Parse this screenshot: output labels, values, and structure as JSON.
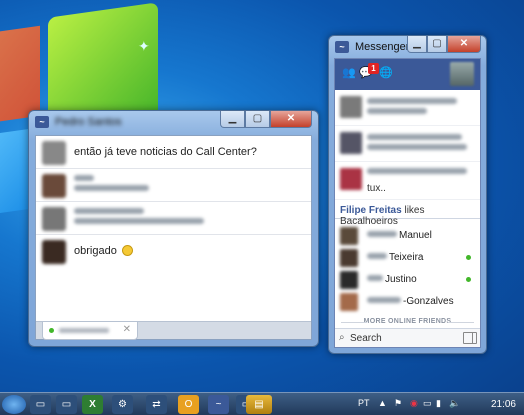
{
  "chat_window": {
    "title": "Pedro Santos",
    "messages": [
      {
        "text": "então já teve noticias do Call Center?",
        "blurred": false,
        "avatar_color": "#888888"
      },
      {
        "text": "",
        "blurred": true,
        "avatar_color": "#6a4a3a"
      },
      {
        "text": "",
        "blurred": true,
        "avatar_color": "#777777"
      },
      {
        "text": "obrigado",
        "blurred": false,
        "emoticon": "smile",
        "avatar_color": "#3a2a22"
      }
    ]
  },
  "messenger": {
    "title": "Messenger",
    "badge_count": "1",
    "notifications": [
      {
        "bold": "Lilian Fonseca",
        "rest": "",
        "avatar_color": "#7a7a7a"
      },
      {
        "bold": "Rosinéia Lopes Dias",
        "rest": "",
        "avatar_color": "#555566"
      },
      {
        "bold": "",
        "rest": "tux..",
        "avatar_color": "#aa3344"
      }
    ],
    "partial_notification": {
      "bold": "Filipe Freitas",
      "rest": "likes Bacalhoeiros"
    },
    "friends": [
      {
        "name": "Manuel",
        "online": false,
        "avatar_color": "#5a4a3a"
      },
      {
        "name": "Teixeira",
        "online": true,
        "avatar_color": "#4a3a30"
      },
      {
        "name": "Justino",
        "online": true,
        "avatar_color": "#2a2a2a"
      },
      {
        "name": "-Gonzalves",
        "online": false,
        "avatar_color": "#a46a4a"
      }
    ],
    "more_label": "MORE ONLINE FRIENDS",
    "search_label": "Search"
  },
  "taskbar": {
    "language": "PT",
    "time": "21:06"
  },
  "colors": {
    "facebook_blue": "#3b5998",
    "online_green": "#42b72a",
    "close_red": "#c4412a"
  }
}
